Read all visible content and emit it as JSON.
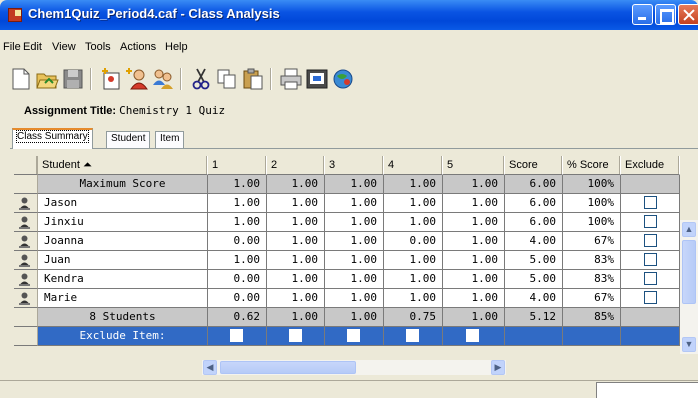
{
  "window": {
    "title": "Chem1Quiz_Period4.caf - Class Analysis"
  },
  "menu": [
    "File",
    "Edit",
    "View",
    "Tools",
    "Actions",
    "Help"
  ],
  "toolbar_icons": [
    "new-file-icon",
    "open-folder-icon",
    "save-disk-icon",
    "add-item-icon",
    "add-student-icon",
    "students-icon",
    "cut-icon",
    "copy-icon",
    "paste-icon",
    "print-icon",
    "preview-icon",
    "web-icon"
  ],
  "assignment": {
    "label": "Assignment Title:",
    "value": "Chemistry 1 Quiz"
  },
  "tabs": [
    "Class Summary",
    "Student",
    "Item"
  ],
  "table": {
    "headers": [
      "Student",
      "1",
      "2",
      "3",
      "4",
      "5",
      "Score",
      "% Score",
      "Exclude"
    ],
    "max_row": {
      "label": "Maximum Score",
      "items": [
        "1.00",
        "1.00",
        "1.00",
        "1.00",
        "1.00"
      ],
      "score": "6.00",
      "pct": "100%"
    },
    "students": [
      {
        "name": "Jason",
        "items": [
          "1.00",
          "1.00",
          "1.00",
          "1.00",
          "1.00"
        ],
        "score": "6.00",
        "pct": "100%"
      },
      {
        "name": "Jinxiu",
        "items": [
          "1.00",
          "1.00",
          "1.00",
          "1.00",
          "1.00"
        ],
        "score": "6.00",
        "pct": "100%"
      },
      {
        "name": "Joanna",
        "items": [
          "0.00",
          "1.00",
          "1.00",
          "0.00",
          "1.00"
        ],
        "score": "4.00",
        "pct": "67%"
      },
      {
        "name": "Juan",
        "items": [
          "1.00",
          "1.00",
          "1.00",
          "1.00",
          "1.00"
        ],
        "score": "5.00",
        "pct": "83%"
      },
      {
        "name": "Kendra",
        "items": [
          "0.00",
          "1.00",
          "1.00",
          "1.00",
          "1.00"
        ],
        "score": "5.00",
        "pct": "83%"
      },
      {
        "name": "Marie",
        "items": [
          "0.00",
          "1.00",
          "1.00",
          "1.00",
          "1.00"
        ],
        "score": "4.00",
        "pct": "67%"
      }
    ],
    "summary": {
      "count": "8",
      "label": "Students",
      "items": [
        "0.62",
        "1.00",
        "1.00",
        "0.75",
        "1.00"
      ],
      "score": "5.12",
      "pct": "85%"
    },
    "exclude_item_label": "Exclude Item:"
  },
  "colors": {
    "title_bar": "#0a54e3",
    "selection_blue": "#316ac5",
    "gray_row": "#c8c8c8"
  }
}
